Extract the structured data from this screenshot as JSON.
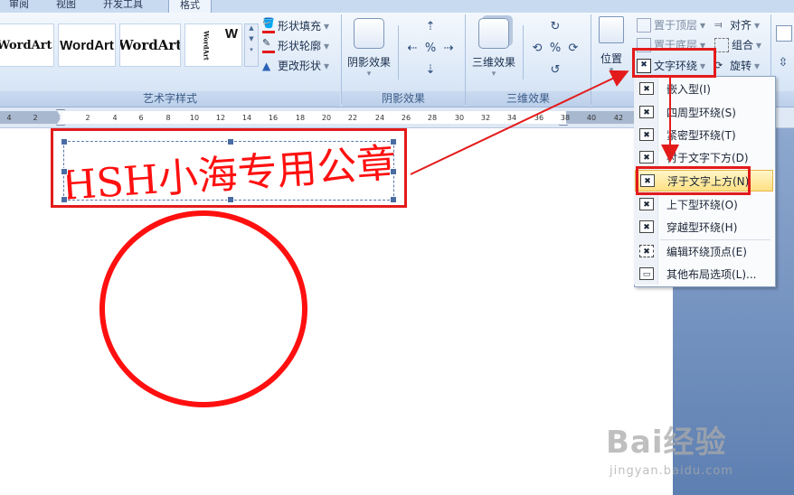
{
  "tabs": [
    {
      "label": "审阅",
      "active": false
    },
    {
      "label": "视图",
      "active": false
    },
    {
      "label": "开发工具",
      "active": false
    },
    {
      "label": "格式",
      "active": true
    }
  ],
  "ribbon": {
    "wordart_styles": {
      "samples": [
        "WordArt",
        "WordArt",
        "WordArt",
        "WordArt",
        "W"
      ],
      "shape_fill": "形状填充",
      "shape_outline": "形状轮廓",
      "change_shape": "更改形状",
      "group_label": "艺术字样式"
    },
    "shadow": {
      "button": "阴影效果",
      "group_label": "阴影效果"
    },
    "threed": {
      "button": "三维效果",
      "group_label": "三维效果"
    },
    "arrange": {
      "position": "位置",
      "bring_front": "置于顶层",
      "send_back": "置于底层",
      "text_wrap": "文字环绕",
      "align": "对齐",
      "group": "组合",
      "rotate": "旋转"
    }
  },
  "ruler": {
    "ticks": [
      "4",
      "2",
      "",
      "2",
      "4",
      "6",
      "8",
      "10",
      "12",
      "14",
      "16",
      "18",
      "20",
      "22",
      "24",
      "26",
      "28",
      "30",
      "32",
      "34",
      "36",
      "38",
      "40",
      "42"
    ]
  },
  "document": {
    "wordart_text": "HSH小海专用公章"
  },
  "wrap_menu": {
    "items": [
      {
        "label": "嵌入型(I)",
        "highlighted": false
      },
      {
        "label": "四周型环绕(S)",
        "highlighted": false
      },
      {
        "label": "紧密型环绕(T)",
        "highlighted": false
      },
      {
        "label": "衬于文字下方(D)",
        "highlighted": false
      },
      {
        "label": "浮于文字上方(N)",
        "highlighted": true
      },
      {
        "label": "上下型环绕(O)",
        "highlighted": false
      },
      {
        "label": "穿越型环绕(H)",
        "highlighted": false
      },
      {
        "label": "编辑环绕顶点(E)",
        "highlighted": false
      },
      {
        "label": "其他布局选项(L)...",
        "highlighted": false
      }
    ]
  },
  "watermark": {
    "logo": "Bai经验",
    "sub": "jingyan.baidu.com"
  },
  "colors": {
    "annotation_red": "#e31b1b",
    "wordart_red": "#ff1010",
    "menu_highlight": "#ffe083"
  }
}
